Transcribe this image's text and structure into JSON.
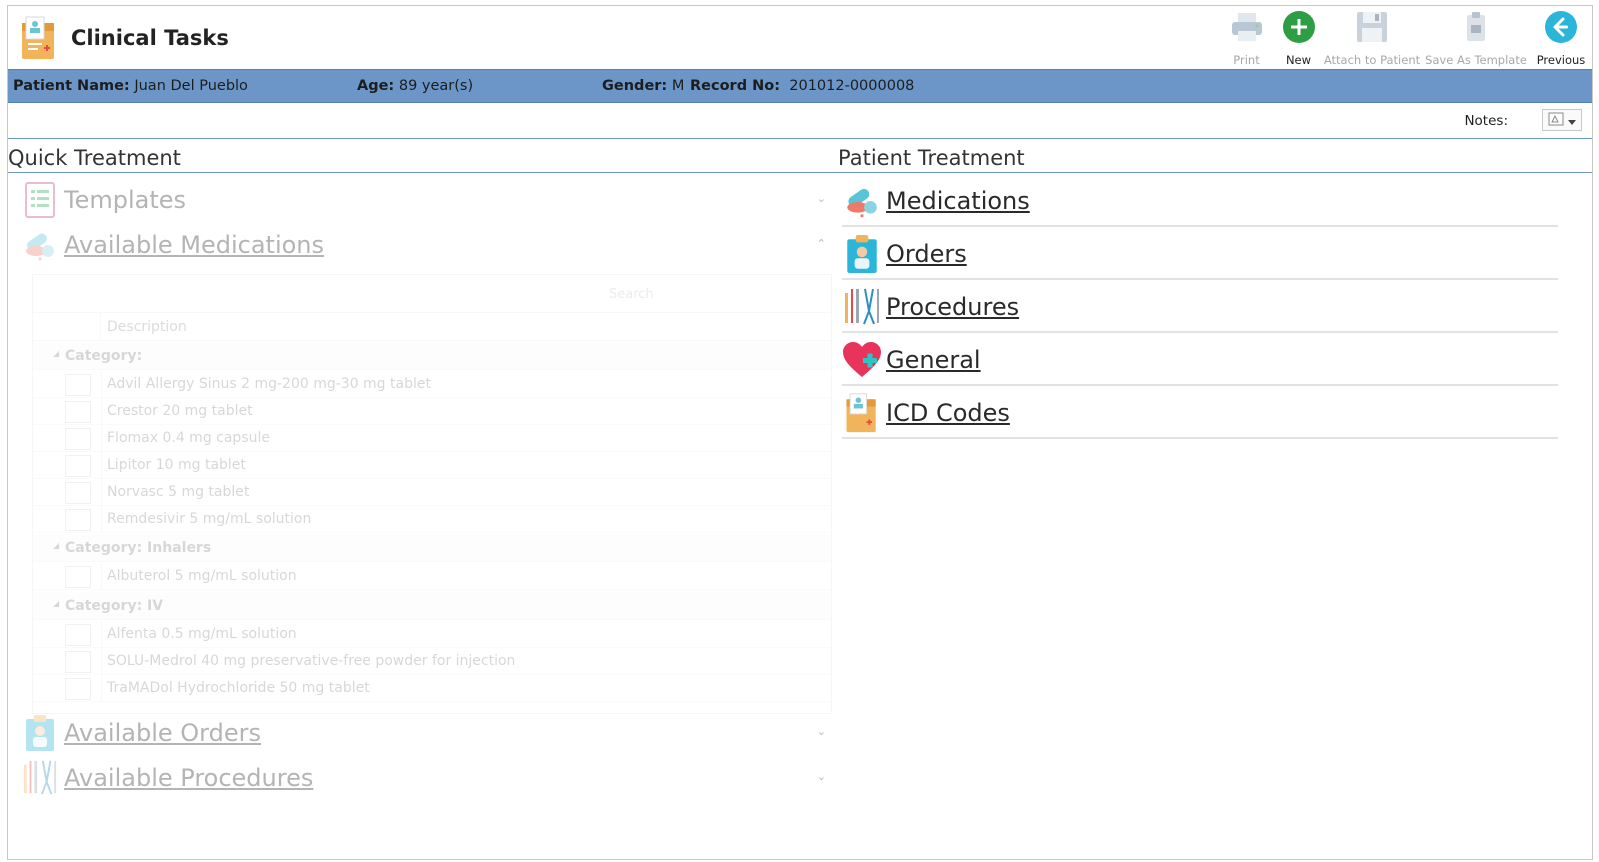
{
  "header": {
    "title": "Clinical Tasks",
    "logo_icon": "patient-file-icon"
  },
  "toolbar": [
    {
      "label": "Print",
      "icon": "printer-icon",
      "enabled": false
    },
    {
      "label": "New",
      "icon": "plus-circle-icon",
      "enabled": true,
      "color": "#2e9e44"
    },
    {
      "label": "Attach to Patient",
      "icon": "save-disk-icon",
      "enabled": false
    },
    {
      "label": "Save As Template",
      "icon": "template-clipboard-icon",
      "enabled": false
    },
    {
      "label": "Previous",
      "icon": "arrow-left-circle-icon",
      "enabled": true,
      "color": "#2ab5d9"
    }
  ],
  "patient": {
    "name_label": "Patient Name:",
    "name": "Juan Del Pueblo",
    "age_label": "Age:",
    "age": "89 year(s)",
    "gender_label": "Gender:",
    "gender": "M",
    "record_label": "Record No:",
    "record": "201012-0000008",
    "bar_color": "#6c96c8"
  },
  "notes": {
    "label": "Notes:"
  },
  "quick_treatment": {
    "title": "Quick Treatment",
    "sections": {
      "templates": "Templates",
      "available_medications": "Available Medications",
      "available_orders": "Available Orders",
      "available_procedures": "Available Procedures"
    },
    "grid": {
      "search_placeholder": "Search",
      "column_description": "Description",
      "groups": [
        {
          "category": "Category:",
          "items": [
            "Advil Allergy Sinus 2 mg-200 mg-30 mg tablet",
            "Crestor 20 mg tablet",
            "Flomax 0.4 mg capsule",
            "Lipitor 10 mg tablet",
            "Norvasc 5 mg tablet",
            "Remdesivir 5 mg/mL solution"
          ]
        },
        {
          "category": "Category: Inhalers",
          "items": [
            "Albuterol 5 mg/mL solution"
          ]
        },
        {
          "category": "Category: IV",
          "items": [
            "Alfenta 0.5 mg/mL solution",
            "SOLU-Medrol 40 mg preservative-free powder for injection",
            "TraMADol Hydrochloride 50 mg tablet"
          ]
        }
      ]
    }
  },
  "patient_treatment": {
    "title": "Patient Treatment",
    "items": [
      {
        "label": "Medications",
        "icon": "pills-icon"
      },
      {
        "label": "Orders",
        "icon": "clipboard-doctor-icon"
      },
      {
        "label": "Procedures",
        "icon": "surgical-tools-icon"
      },
      {
        "label": "General",
        "icon": "heart-plus-icon"
      },
      {
        "label": "ICD Codes",
        "icon": "patient-file-icon"
      }
    ]
  }
}
